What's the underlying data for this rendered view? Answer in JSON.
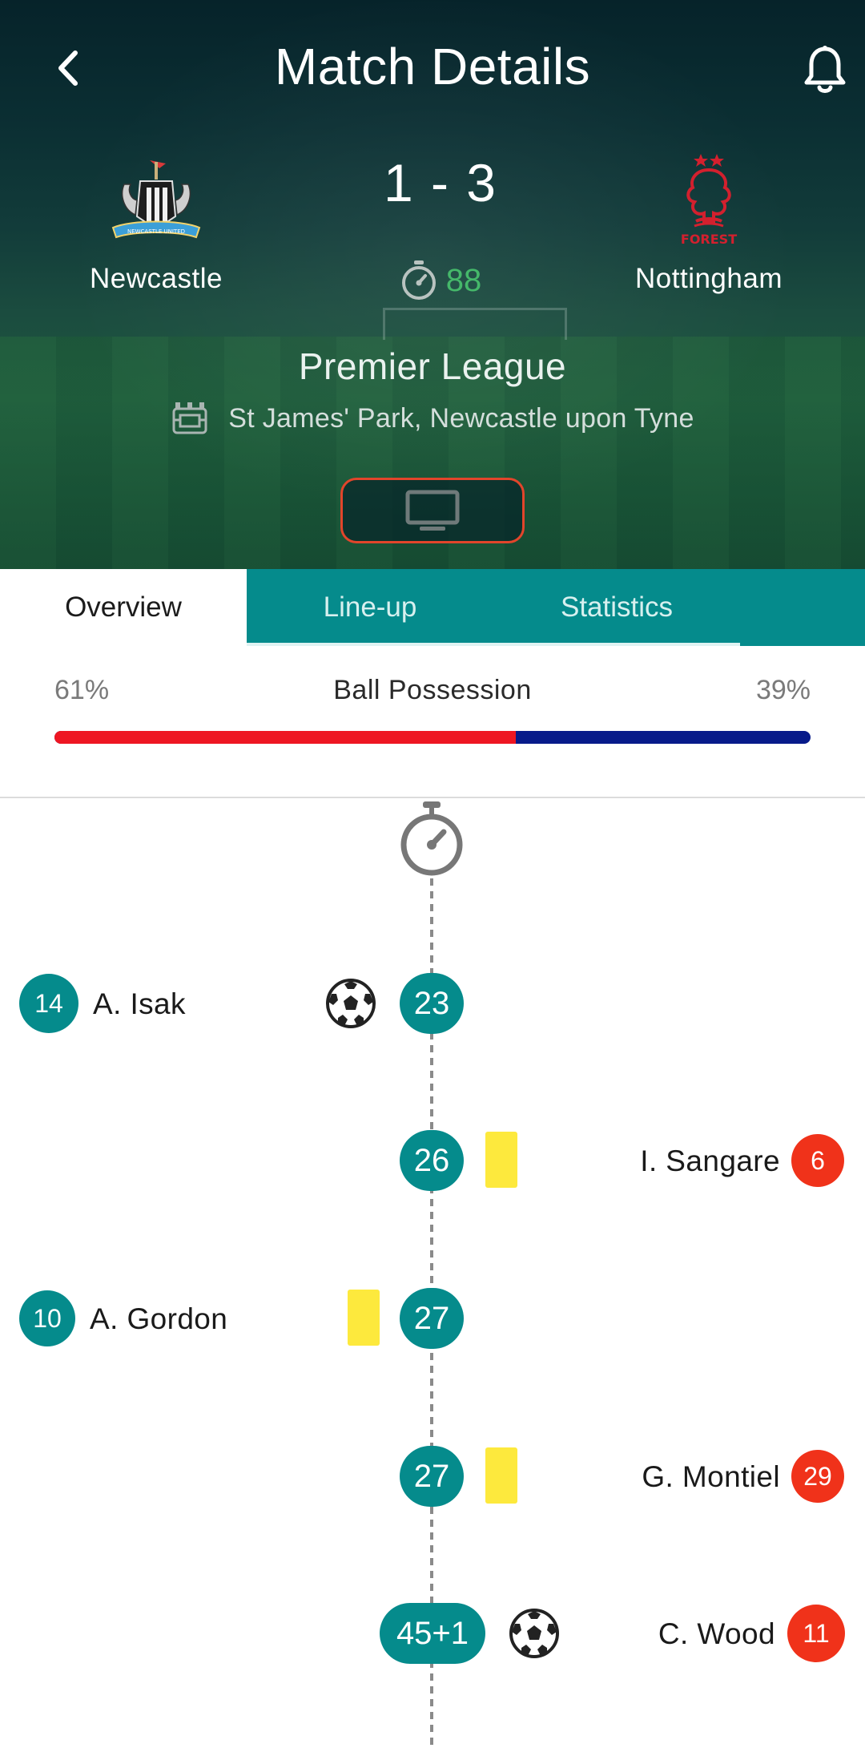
{
  "header": {
    "title": "Match Details",
    "score": "1 - 3",
    "minute": "88",
    "league": "Premier League",
    "venue": "St James' Park, Newcastle upon Tyne",
    "home_team": "Newcastle",
    "away_team": "Nottingham",
    "icons": {
      "back": "chevron-left-icon",
      "notify": "bell-icon",
      "timer": "stopwatch-icon",
      "stadium": "stadium-icon",
      "tv": "tv-icon"
    },
    "accent_colors": {
      "minute": "#45b86a",
      "tv_border": "#e2452b"
    }
  },
  "tabs": [
    {
      "label": "Overview",
      "active": true
    },
    {
      "label": "Line-up",
      "active": false
    },
    {
      "label": "Statistics",
      "active": false
    }
  ],
  "possession": {
    "label": "Ball Possession",
    "home_text": "61%",
    "away_text": "39%",
    "home_value": 61,
    "away_value": 39,
    "home_color": "#ee1622",
    "away_color": "#071a8a"
  },
  "timeline": {
    "events": [
      {
        "side": "home",
        "minute": "23",
        "type": "goal",
        "player": "A. Isak",
        "number": "14"
      },
      {
        "side": "away",
        "minute": "26",
        "type": "yellow-card",
        "player": "I. Sangare",
        "number": "6"
      },
      {
        "side": "home",
        "minute": "27",
        "type": "yellow-card",
        "player": "A. Gordon",
        "number": "10"
      },
      {
        "side": "away",
        "minute": "27",
        "type": "yellow-card",
        "player": "G. Montiel",
        "number": "29"
      },
      {
        "side": "away",
        "minute": "45+1",
        "type": "goal",
        "player": "C. Wood",
        "number": "11"
      }
    ]
  },
  "theme": {
    "primary": "#058b8c",
    "away_badge": "#f0321a",
    "yellow_card": "#fde93d"
  }
}
